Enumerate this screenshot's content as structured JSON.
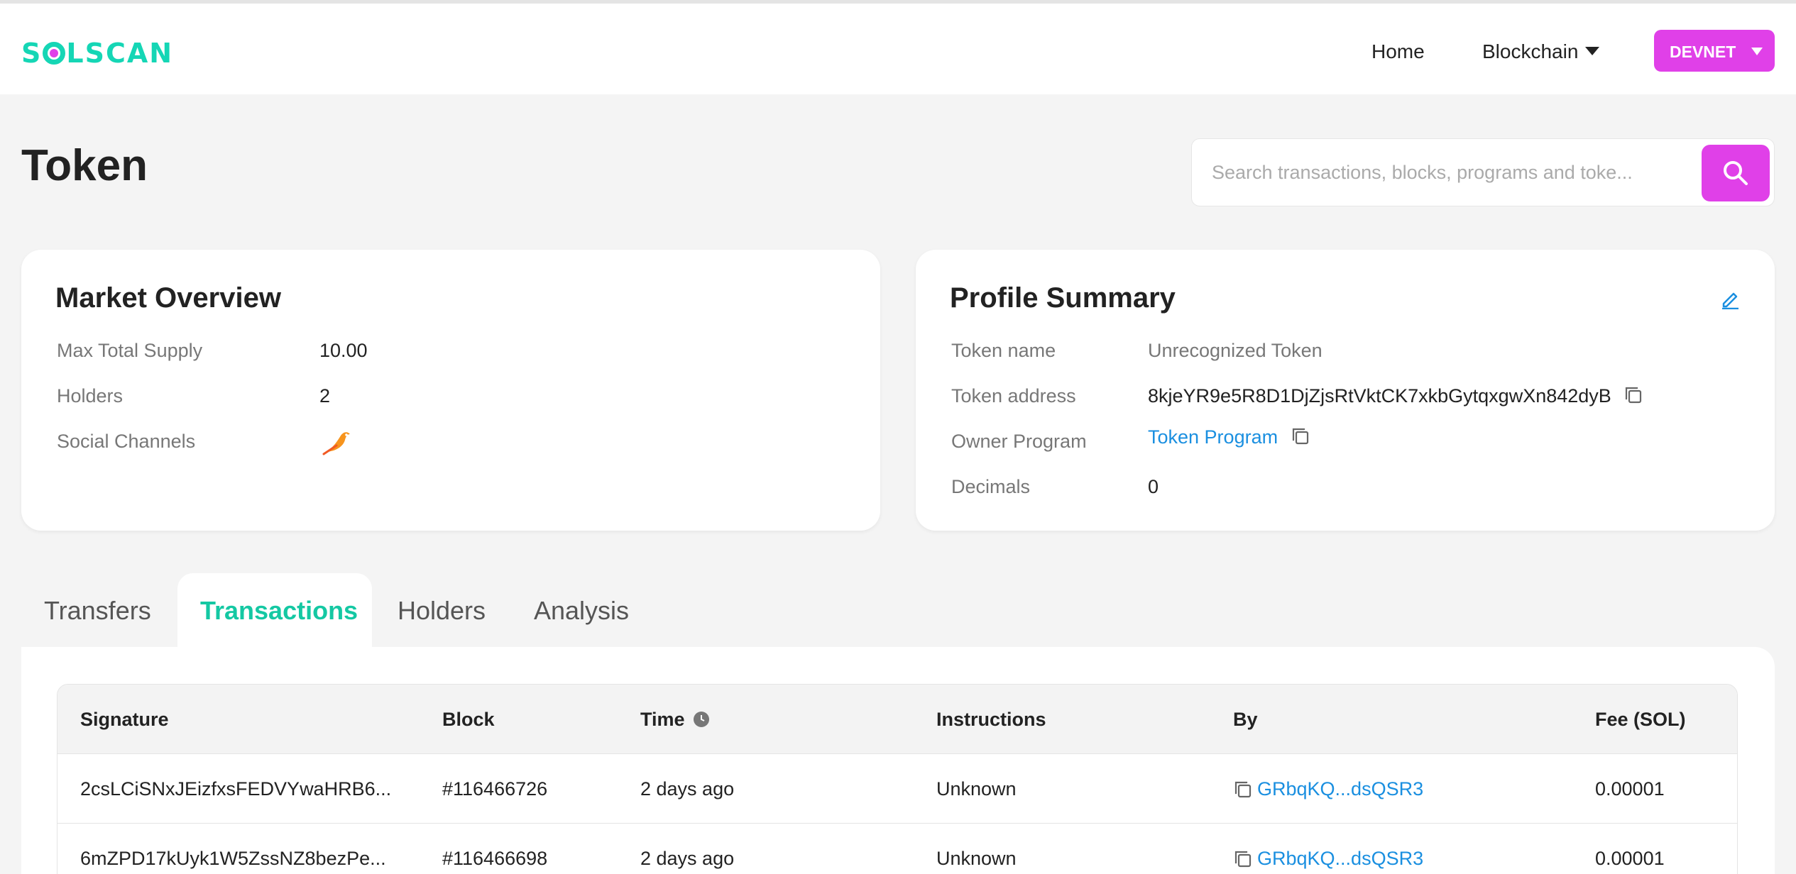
{
  "header": {
    "logo_text": "SOLSCAN",
    "nav_home": "Home",
    "nav_blockchain": "Blockchain",
    "network": "DEVNET",
    "brand_color": "#15d6b5",
    "accent_color": "#e040e8"
  },
  "page": {
    "title": "Token"
  },
  "search": {
    "placeholder": "Search transactions, blocks, programs and toke..."
  },
  "market": {
    "title": "Market Overview",
    "rows": [
      {
        "label": "Max Total Supply",
        "value": "10.00"
      },
      {
        "label": "Holders",
        "value": "2"
      },
      {
        "label": "Social Channels",
        "value": ""
      }
    ],
    "social_icon": "bird-icon"
  },
  "profile": {
    "title": "Profile Summary",
    "rows": [
      {
        "label": "Token name",
        "value": "Unrecognized Token"
      },
      {
        "label": "Token address",
        "value": "8kjeYR9e5R8D1DjZjsRtVktCK7xkbGytqxgwXn842dyB"
      },
      {
        "label": "Owner Program",
        "value": "Token Program"
      },
      {
        "label": "Decimals",
        "value": "0"
      }
    ],
    "edit_icon": "pencil-icon"
  },
  "tabs": [
    {
      "label": "Transfers",
      "active": false
    },
    {
      "label": "Transactions",
      "active": true
    },
    {
      "label": "Holders",
      "active": false
    },
    {
      "label": "Analysis",
      "active": false
    }
  ],
  "table": {
    "columns": [
      "Signature",
      "Block",
      "Time",
      "Instructions",
      "By",
      "Fee (SOL)"
    ],
    "rows": [
      {
        "signature": "2csLCiSNxJEizfxsFEDVYwaHRB6...",
        "block": "#116466726",
        "time": "2 days ago",
        "instructions": "Unknown",
        "by": "GRbqKQ...dsQSR3",
        "fee": "0.00001"
      },
      {
        "signature": "6mZPD17kUyk1W5ZssNZ8bezPe...",
        "block": "#116466698",
        "time": "2 days ago",
        "instructions": "Unknown",
        "by": "GRbqKQ...dsQSR3",
        "fee": "0.00001"
      }
    ]
  }
}
